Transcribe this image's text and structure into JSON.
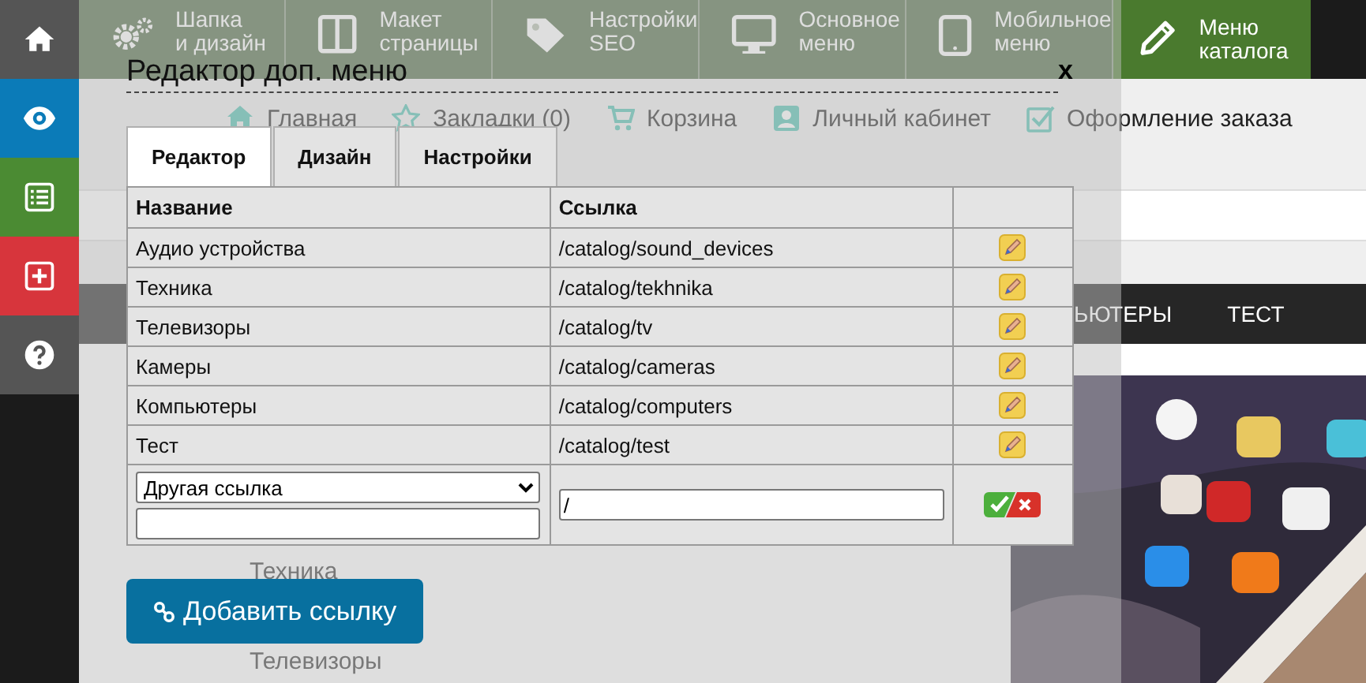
{
  "sidebar": {
    "items": [
      {
        "kind": "home",
        "color": "#555555"
      },
      {
        "kind": "eye",
        "color": "#0b7bb8"
      },
      {
        "kind": "list",
        "color": "#4b8b33"
      },
      {
        "kind": "plus",
        "color": "#d7353c"
      },
      {
        "kind": "help",
        "color": "#555555"
      }
    ]
  },
  "toolbar": {
    "items": [
      {
        "kind": "gears",
        "lines": [
          "Шапка",
          "и дизайн"
        ],
        "selected": false
      },
      {
        "kind": "layout",
        "lines": [
          "Макет",
          "страницы"
        ],
        "selected": false
      },
      {
        "kind": "tag",
        "lines": [
          "Настройки",
          "SEO"
        ],
        "selected": false
      },
      {
        "kind": "monitor",
        "lines": [
          "Основное",
          "меню"
        ],
        "selected": false
      },
      {
        "kind": "tablet",
        "lines": [
          "Мобильное",
          "меню"
        ],
        "selected": false
      },
      {
        "kind": "pencil",
        "lines": [
          "Меню",
          "каталога"
        ],
        "selected": true
      }
    ]
  },
  "site_nav": {
    "items": [
      {
        "kind": "home",
        "label": "Главная"
      },
      {
        "kind": "star",
        "label": "Закладки (0)"
      },
      {
        "kind": "cart",
        "label": "Корзина"
      },
      {
        "kind": "user",
        "label": "Личный кабинет"
      },
      {
        "kind": "check",
        "label": "Оформление заказа"
      }
    ]
  },
  "catalog_menu": {
    "items": [
      "ЬЮТЕРЫ",
      "ТЕСТ"
    ]
  },
  "side_list": [
    "Техника",
    "Телевизоры"
  ],
  "dialog": {
    "title": "Редактор доп. меню",
    "close": "x",
    "tabs": [
      {
        "label": "Редактор",
        "selected": true
      },
      {
        "label": "Дизайн",
        "selected": false
      },
      {
        "label": "Настройки",
        "selected": false
      }
    ],
    "table": {
      "columns": [
        "Название",
        "Ссылка"
      ],
      "rows": [
        {
          "name": "Аудио устройства",
          "link": "/catalog/sound_devices"
        },
        {
          "name": "Техника",
          "link": "/catalog/tekhnika"
        },
        {
          "name": "Телевизоры",
          "link": "/catalog/tv"
        },
        {
          "name": "Камеры",
          "link": "/catalog/cameras"
        },
        {
          "name": "Компьютеры",
          "link": "/catalog/computers"
        },
        {
          "name": "Тест",
          "link": "/catalog/test"
        }
      ],
      "new_row": {
        "link_type": "Другая ссылка",
        "link": "/"
      }
    },
    "add_button": "Добавить ссылку"
  }
}
